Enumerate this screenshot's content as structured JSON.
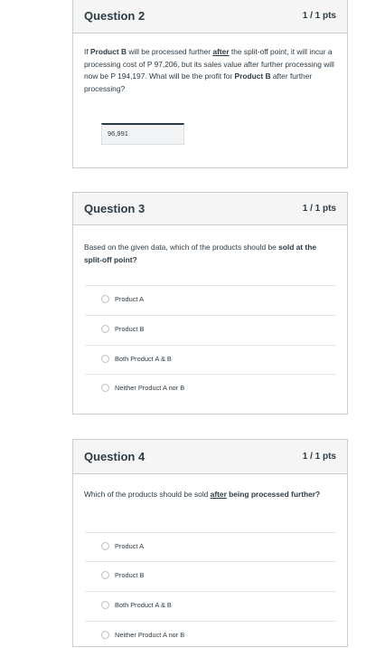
{
  "q2": {
    "title": "Question 2",
    "pts": "1 / 1 pts",
    "text_1": "If ",
    "text_product": "Product B",
    "text_2": " will be processed further ",
    "text_after": "after",
    "text_3": " the split-off point, it will incur a processing cost of P 97,206, but its sales value after further processing will now be P 194,197. What will be the profit for ",
    "text_product2": "Product B",
    "text_4": " after further processing?",
    "answer": "96,991"
  },
  "q3": {
    "title": "Question 3",
    "pts": "1 / 1 pts",
    "text_1": "Based on the given data, which of the products should be ",
    "text_bold": "sold at the split-off point?",
    "options": [
      "Product A",
      "Product B",
      "Both Product A & B",
      "Neither Product A nor B"
    ]
  },
  "q4": {
    "title": "Question 4",
    "pts": "1 / 1 pts",
    "text_1": "Which of the products should be sold ",
    "text_after": "after",
    "text_2": " being processed further?",
    "options": [
      "Product A",
      "Product B",
      "Both Product A & B",
      "Neither Product A nor B"
    ]
  }
}
